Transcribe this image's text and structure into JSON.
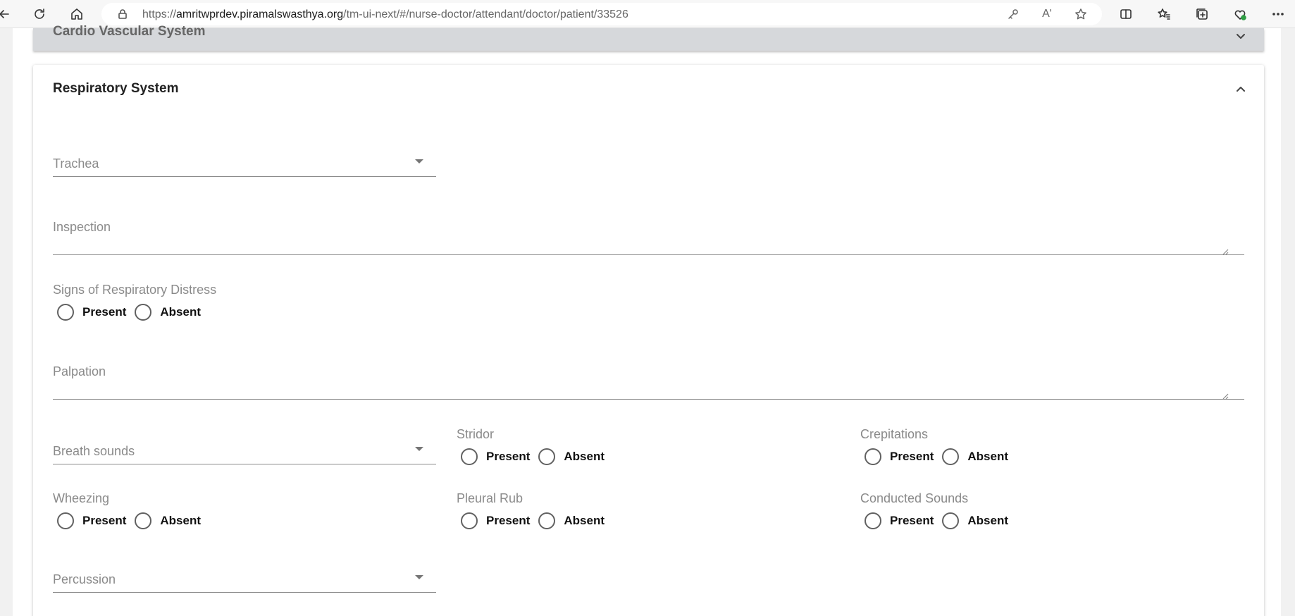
{
  "browser": {
    "url_prefix": "https://",
    "url_host": "amritwprdev.piramalswasthya.org",
    "url_path": "/tm-ui-next/#/nurse-doctor/attendant/doctor/patient/33526",
    "read_aloud": "Aʹ"
  },
  "collapsed_panel": {
    "title": "Cardio Vascular System"
  },
  "panel": {
    "title": "Respiratory System",
    "trachea": {
      "label": "Trachea"
    },
    "inspection": {
      "label": "Inspection"
    },
    "respiratory_distress": {
      "label": "Signs of Respiratory Distress",
      "present": "Present",
      "absent": "Absent"
    },
    "palpation": {
      "label": "Palpation"
    },
    "breath_sounds": {
      "label": "Breath sounds"
    },
    "stridor": {
      "label": "Stridor",
      "present": "Present",
      "absent": "Absent"
    },
    "crepitations": {
      "label": "Crepitations",
      "present": "Present",
      "absent": "Absent"
    },
    "wheezing": {
      "label": "Wheezing",
      "present": "Present",
      "absent": "Absent"
    },
    "pleural_rub": {
      "label": "Pleural Rub",
      "present": "Present",
      "absent": "Absent"
    },
    "conducted_sounds": {
      "label": "Conducted Sounds",
      "present": "Present",
      "absent": "Absent"
    },
    "percussion": {
      "label": "Percussion"
    }
  }
}
